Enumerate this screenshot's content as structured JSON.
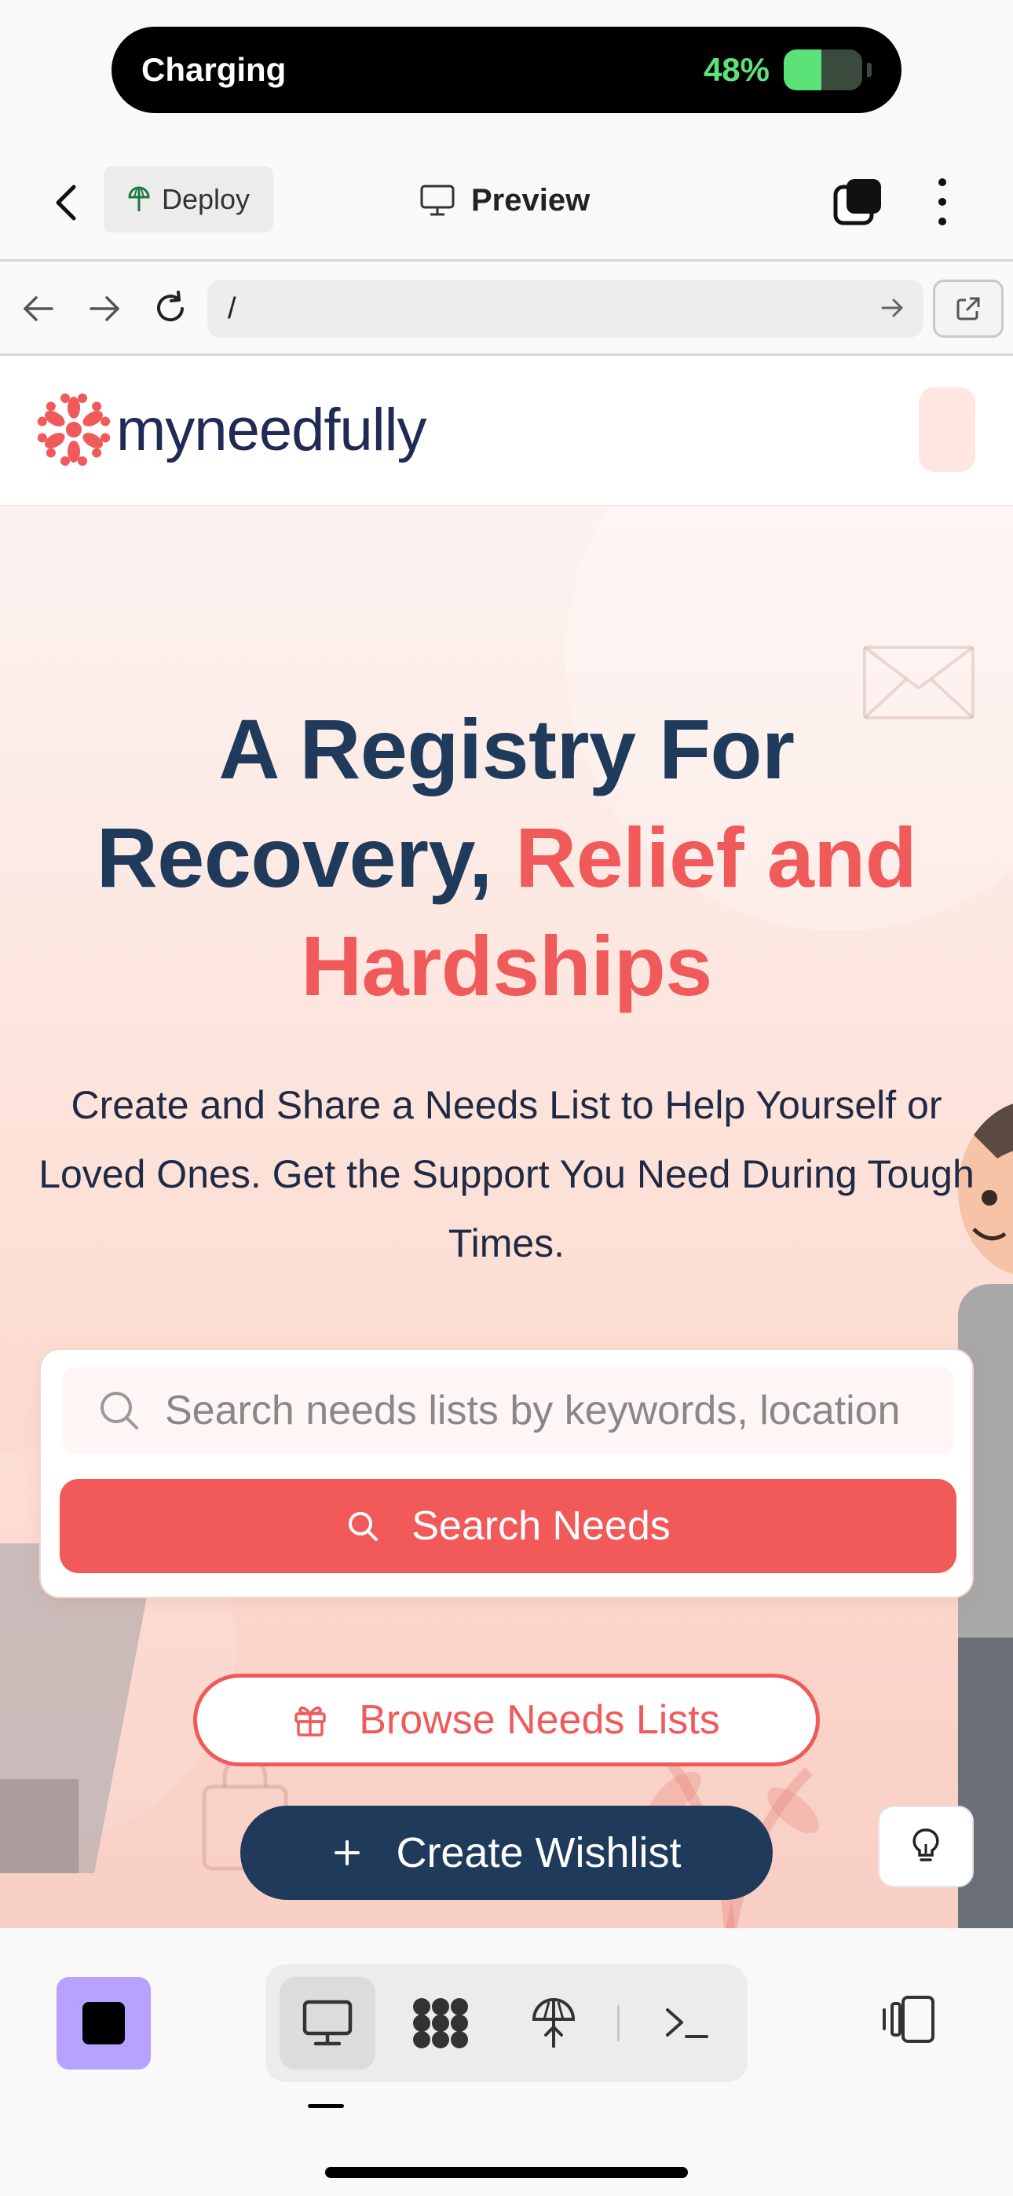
{
  "status": {
    "charging_label": "Charging",
    "battery_percent": "48%",
    "battery_level": 0.48
  },
  "app_bar": {
    "deploy_label": "Deploy",
    "preview_label": "Preview"
  },
  "url_bar": {
    "url": "/"
  },
  "site": {
    "logo_text": "myneedfully",
    "brand_color": "#f05a5a",
    "navy_color": "#1f3a5a"
  },
  "hero": {
    "title_line1": "A Registry For",
    "title_line2a": "Recovery, ",
    "title_line2b": "Relief and",
    "title_line3": "Hardships",
    "subtitle": "Create and Share a Needs List to Help Yourself or Loved Ones. Get the Support You Need During Tough Times.",
    "search_placeholder": "Search needs lists by keywords, location",
    "search_button": "Search Needs",
    "browse_button": "Browse Needs Lists",
    "create_button": "Create Wishlist"
  },
  "icons": {
    "back": "chevron-left-icon",
    "deploy": "deploy-icon",
    "preview": "monitor-icon",
    "tabs": "tabs-icon",
    "menu": "kebab-menu-icon",
    "search": "search-icon",
    "gift": "gift-icon",
    "plus": "plus-icon",
    "tip": "lightbulb-icon"
  }
}
